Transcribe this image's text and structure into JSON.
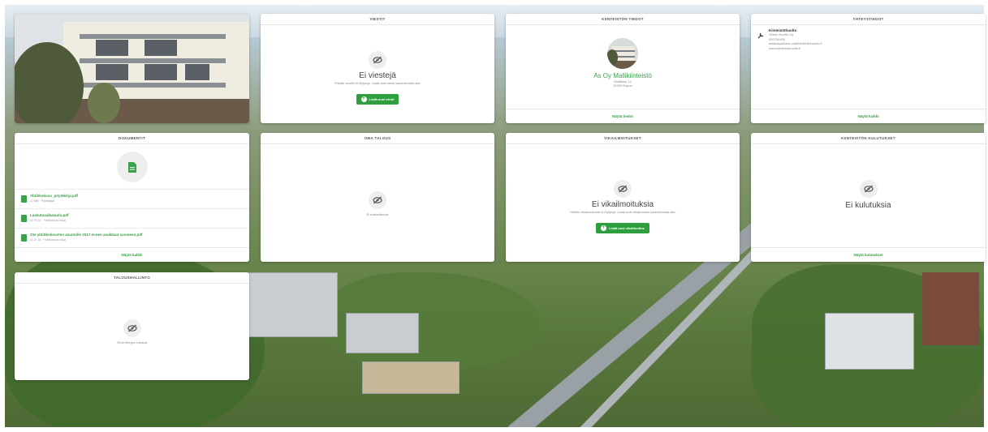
{
  "photo": {
    "alt_icon": "apartment-building-photo"
  },
  "messages": {
    "title": "VIESTIT",
    "empty_title": "Ei viestejä",
    "empty_text": "Yhtään viestiä ei löytynyt. Lisää uusi viesti sarkemmalta alla.",
    "add_button": "Lisää uusi viesti"
  },
  "property": {
    "title": "KIINTEISTÖN TIEDOT",
    "name": "As Oy Mallikiinteistö",
    "street": "Mallikatu 12",
    "city": "02200 Espoo",
    "footer": "Näytä tiedot"
  },
  "contacts": {
    "title": "YHTEYSTIEDOT",
    "role": "Kiinteistöhuolto",
    "lines": [
      "Olavin Huolto Oy",
      "020700400",
      "asiakaspalvelu.on@kiinteistohuolto.fi",
      "www.kiinteistohuolto.fi"
    ],
    "footer": "Näytä kaikki"
  },
  "documents": {
    "title": "DOKUMENTIT",
    "items": [
      {
        "name": "Yhtiökokous_pöytäkirja.pdf",
        "meta": "11 Mär · Pöytäkirjat"
      },
      {
        "name": "Laskutusaikataulu.pdf",
        "meta": "11.03.24 · Yhtiökokous kirjat"
      },
      {
        "name": "Ote yhtiökokousten asuntolle 2017 ennen asukkaat suomeen.pdf",
        "meta": "11.07.16 · Yhtiökokous kirjat"
      }
    ],
    "footer": "Näytä kaikki"
  },
  "finances": {
    "title": "OMA TALOUS",
    "empty_text": "Ei maksutietoja"
  },
  "defects": {
    "title": "VIKAILMOITUKSET",
    "empty_title": "Ei vikailmoituksia",
    "empty_text": "Yhtään vikailmoitusta ei löytynyt. Lisää uusi vikailmoitus sarkemmalta alla.",
    "add_button": "Lisää uusi vikailmoitus"
  },
  "consumption": {
    "title": "KIINTEISTÖN KULUTUKSET",
    "empty_title": "Ei kulutuksia",
    "footer": "Näytä kulutukset"
  },
  "accounting": {
    "title": "TALOUSHALLINTO",
    "empty_text": "Virhe tietojen haussa"
  },
  "colors": {
    "accent": "#3aa04a",
    "button": "#2f9e3f"
  }
}
